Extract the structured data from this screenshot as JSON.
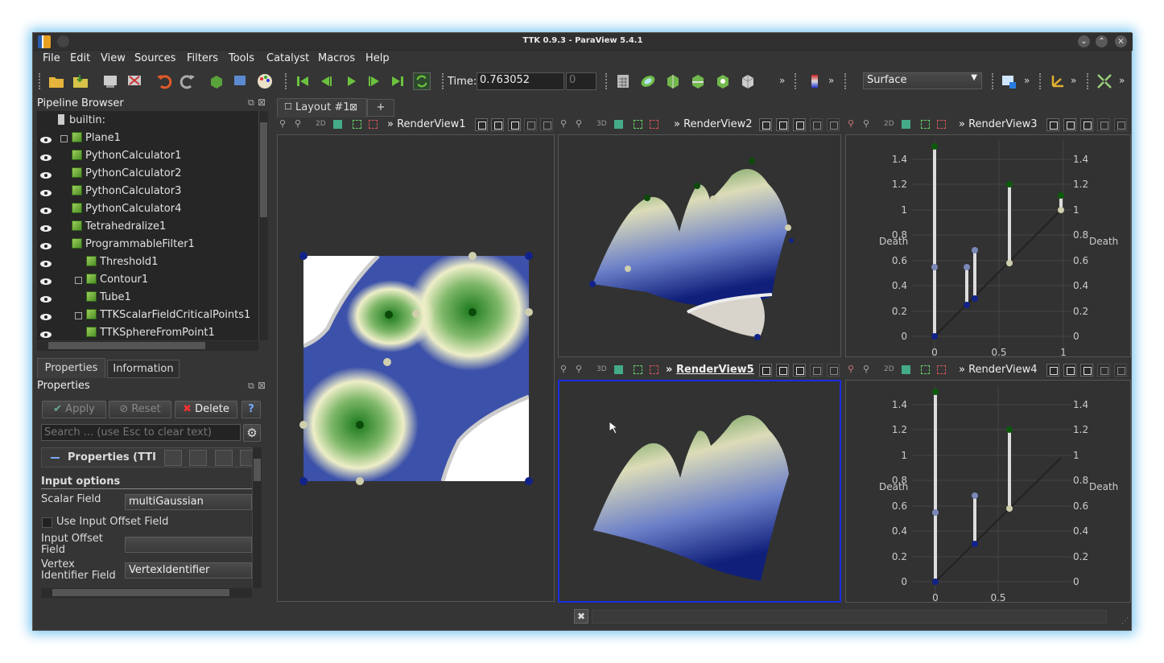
{
  "window": {
    "title": "TTK 0.9.3 - ParaView 5.4.1"
  },
  "menu": [
    "File",
    "Edit",
    "View",
    "Sources",
    "Filters",
    "Tools",
    "Catalyst",
    "Macros",
    "Help"
  ],
  "toolbar": {
    "time_label": "Time:",
    "time_value": "0.763052",
    "time_index": "0",
    "representation": "Surface"
  },
  "pipeline": {
    "title": "Pipeline Browser",
    "items": [
      "builtin:",
      "Plane1",
      "PythonCalculator1",
      "PythonCalculator2",
      "PythonCalculator3",
      "PythonCalculator4",
      "Tetrahedralize1",
      "ProgrammableFilter1",
      "Threshold1",
      "Contour1",
      "Tube1",
      "TTKScalarFieldCriticalPoints1",
      "TTKSphereFromPoint1"
    ]
  },
  "tabs": {
    "properties": "Properties",
    "information": "Information"
  },
  "properties": {
    "title": "Properties",
    "apply": "Apply",
    "reset": "Reset",
    "delete": "Delete",
    "help": "?",
    "search_placeholder": "Search ... (use Esc to clear text)",
    "section_header": "Properties (TTI",
    "input_options": "Input options",
    "scalar_field_label": "Scalar Field",
    "scalar_field_value": "multiGaussian",
    "use_offset_label": "Use Input Offset Field",
    "offset_label": "Input Offset Field",
    "vertex_label": "Vertex Identifier Field",
    "vertex_value": "VertexIdentifier"
  },
  "layout": {
    "tab": "Layout #1",
    "add": "+"
  },
  "views": {
    "rv1": "RenderView1",
    "rv2": "RenderView2",
    "rv3": "RenderView3",
    "rv4": "RenderView4",
    "rv5": "RenderView5",
    "tag2d": "2D",
    "tag3d": "3D"
  },
  "diagrams": {
    "ylabel": "Death",
    "yticks": [
      "0",
      "0.2",
      "0.4",
      "0.6",
      "0.8",
      "1",
      "1.2",
      "1.4"
    ],
    "xticks3": [
      "0",
      "0.5",
      "1"
    ],
    "xticks4": [
      "0",
      "0.5"
    ]
  }
}
